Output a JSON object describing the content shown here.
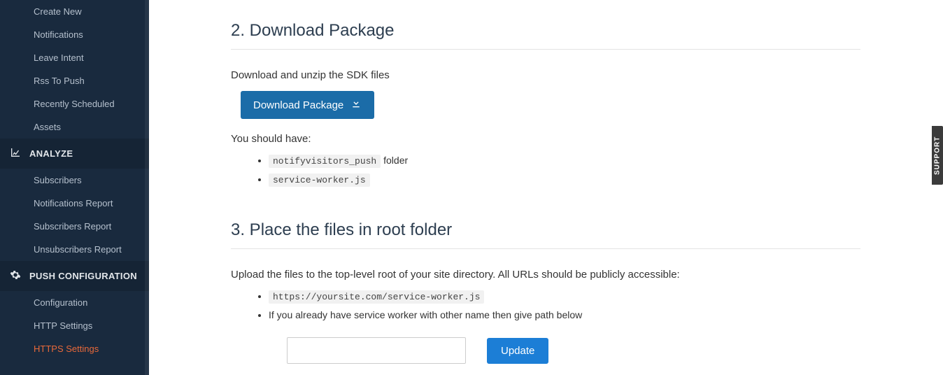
{
  "sidebar": {
    "group_create": {
      "items": [
        "Create New",
        "Notifications",
        "Leave Intent",
        "Rss To Push",
        "Recently Scheduled",
        "Assets"
      ]
    },
    "group_analyze": {
      "header": "ANALYZE",
      "items": [
        "Subscribers",
        "Notifications Report",
        "Subscribers Report",
        "Unsubscribers Report"
      ]
    },
    "group_push": {
      "header": "PUSH CONFIGURATION",
      "items": [
        "Configuration",
        "HTTP Settings",
        "HTTPS Settings"
      ]
    }
  },
  "section2": {
    "title": "2. Download Package",
    "intro": "Download and unzip the SDK files",
    "button": "Download Package",
    "should_have": "You should have:",
    "file1": "notifyvisitors_push",
    "file1_suffix": " folder",
    "file2": "service-worker.js"
  },
  "section3": {
    "title": "3. Place the files in root folder",
    "intro": "Upload the files to the top-level root of your site directory. All URLs should be publicly accessible:",
    "url": "https://yoursite.com/service-worker.js",
    "note": "If you already have service worker with other name then give path below",
    "update": "Update"
  },
  "support": "SUPPORT"
}
